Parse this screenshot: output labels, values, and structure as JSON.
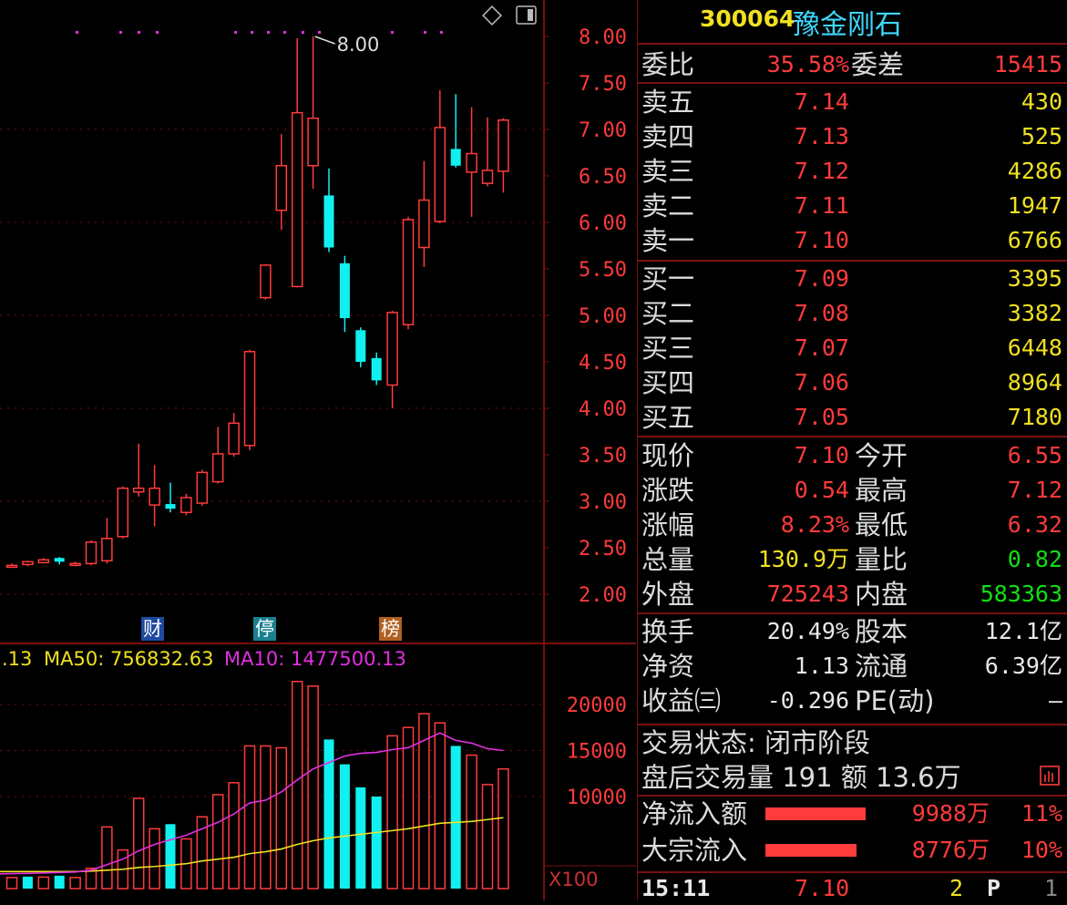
{
  "header": {
    "code": "300064",
    "name": "豫金刚石"
  },
  "window_icons": {
    "diamond": "diamond-icon",
    "toggle": "panel-toggle-icon"
  },
  "weibi": {
    "label": "委比",
    "value": "35.58%",
    "diff_label": "委差",
    "diff_value": "15415"
  },
  "sell": [
    {
      "label": "卖五",
      "price": "7.14",
      "vol": "430"
    },
    {
      "label": "卖四",
      "price": "7.13",
      "vol": "525"
    },
    {
      "label": "卖三",
      "price": "7.12",
      "vol": "4286"
    },
    {
      "label": "卖二",
      "price": "7.11",
      "vol": "1947"
    },
    {
      "label": "卖一",
      "price": "7.10",
      "vol": "6766"
    }
  ],
  "buy": [
    {
      "label": "买一",
      "price": "7.09",
      "vol": "3395"
    },
    {
      "label": "买二",
      "price": "7.08",
      "vol": "3382"
    },
    {
      "label": "买三",
      "price": "7.07",
      "vol": "6448"
    },
    {
      "label": "买四",
      "price": "7.06",
      "vol": "8964"
    },
    {
      "label": "买五",
      "price": "7.05",
      "vol": "7180"
    }
  ],
  "stats": [
    {
      "l1": "现价",
      "v1": "7.10",
      "c1": "red",
      "l2": "今开",
      "v2": "6.55",
      "c2": "red"
    },
    {
      "l1": "涨跌",
      "v1": "0.54",
      "c1": "red",
      "l2": "最高",
      "v2": "7.12",
      "c2": "red"
    },
    {
      "l1": "涨幅",
      "v1": "8.23%",
      "c1": "red",
      "l2": "最低",
      "v2": "6.32",
      "c2": "red"
    },
    {
      "l1": "总量",
      "v1": "130.9万",
      "c1": "yellow",
      "l2": "量比",
      "v2": "0.82",
      "c2": "green"
    },
    {
      "l1": "外盘",
      "v1": "725243",
      "c1": "red",
      "l2": "内盘",
      "v2": "583363",
      "c2": "green"
    }
  ],
  "stats2": [
    {
      "l1": "换手",
      "v1": "20.49%",
      "l2": "股本",
      "v2": "12.1亿"
    },
    {
      "l1": "净资",
      "v1": "1.13",
      "l2": "流通",
      "v2": "6.39亿"
    },
    {
      "l1": "收益㈢",
      "v1": "-0.296",
      "l2": "PE(动)",
      "v2": "–"
    }
  ],
  "trade_status": "交易状态: 闭市阶段",
  "after_hours": "盘后交易量 191 额 13.6万",
  "flows": [
    {
      "label": "净流入额",
      "value": "9988万",
      "pct": "11%",
      "fill": 0.11
    },
    {
      "label": "大宗流入",
      "value": "8776万",
      "pct": "10%",
      "fill": 0.1
    }
  ],
  "bottom": {
    "time": "15:11",
    "price": "7.10",
    "count": "2",
    "flag": "P",
    "num": "1"
  },
  "chart_labels": {
    "max_marker": "8.00",
    "ma_line_prefix": ".13",
    "ma50": "MA50: 756832.63",
    "ma10": "MA10: 1477500.13",
    "unit": "X100",
    "tags": [
      {
        "text": "财",
        "bg": "#1e4aa0"
      },
      {
        "text": "停",
        "bg": "#1a8090"
      },
      {
        "text": "榜",
        "bg": "#b06020"
      }
    ]
  },
  "colors": {
    "up": "#ff3b3b",
    "down": "#10f0f0",
    "grid": "#7a0f0f",
    "ma50": "#f0e020",
    "ma10": "#e030e0"
  },
  "chart_data": [
    {
      "type": "candlestick",
      "y_ticks": [
        "8.00",
        "7.50",
        "7.00",
        "6.50",
        "6.00",
        "5.50",
        "5.00",
        "4.50",
        "4.00",
        "3.50",
        "3.00",
        "2.50",
        "2.00"
      ],
      "ylim": [
        1.5,
        8.2
      ],
      "candles": [
        {
          "o": 2.31,
          "c": 2.31,
          "h": 2.33,
          "l": 2.29
        },
        {
          "o": 2.32,
          "c": 2.35,
          "h": 2.36,
          "l": 2.3
        },
        {
          "o": 2.34,
          "c": 2.37,
          "h": 2.39,
          "l": 2.33
        },
        {
          "o": 2.39,
          "c": 2.35,
          "h": 2.4,
          "l": 2.32
        },
        {
          "o": 2.33,
          "c": 2.33,
          "h": 2.35,
          "l": 2.3
        },
        {
          "o": 2.33,
          "c": 2.56,
          "h": 2.58,
          "l": 2.31
        },
        {
          "o": 2.36,
          "c": 2.6,
          "h": 2.82,
          "l": 2.33
        },
        {
          "o": 2.62,
          "c": 3.14,
          "h": 3.16,
          "l": 2.6
        },
        {
          "o": 3.1,
          "c": 3.14,
          "h": 3.62,
          "l": 3.05
        },
        {
          "o": 2.96,
          "c": 3.14,
          "h": 3.39,
          "l": 2.73
        },
        {
          "o": 2.97,
          "c": 2.92,
          "h": 3.2,
          "l": 2.88
        },
        {
          "o": 2.88,
          "c": 3.04,
          "h": 3.08,
          "l": 2.85
        },
        {
          "o": 2.98,
          "c": 3.31,
          "h": 3.34,
          "l": 2.95
        },
        {
          "o": 3.21,
          "c": 3.51,
          "h": 3.8,
          "l": 3.19
        },
        {
          "o": 3.51,
          "c": 3.84,
          "h": 3.95,
          "l": 3.48
        },
        {
          "o": 3.6,
          "c": 4.61,
          "h": 4.63,
          "l": 3.55
        },
        {
          "o": 5.19,
          "c": 5.54,
          "h": 5.55,
          "l": 5.17
        },
        {
          "o": 6.13,
          "c": 6.61,
          "h": 6.95,
          "l": 5.92
        },
        {
          "o": 5.31,
          "c": 7.18,
          "h": 7.98,
          "l": 5.3
        },
        {
          "o": 6.61,
          "c": 7.12,
          "h": 8.0,
          "l": 6.36
        },
        {
          "o": 6.29,
          "c": 5.73,
          "h": 6.58,
          "l": 5.68
        },
        {
          "o": 5.56,
          "c": 4.97,
          "h": 5.64,
          "l": 4.82
        },
        {
          "o": 4.84,
          "c": 4.5,
          "h": 4.87,
          "l": 4.44
        },
        {
          "o": 4.54,
          "c": 4.3,
          "h": 4.6,
          "l": 4.25
        },
        {
          "o": 4.25,
          "c": 5.03,
          "h": 5.05,
          "l": 4.0
        },
        {
          "o": 4.9,
          "c": 6.03,
          "h": 6.06,
          "l": 4.85
        },
        {
          "o": 5.73,
          "c": 6.24,
          "h": 6.66,
          "l": 5.52
        },
        {
          "o": 6.01,
          "c": 7.02,
          "h": 7.42,
          "l": 5.99
        },
        {
          "o": 6.79,
          "c": 6.61,
          "h": 7.38,
          "l": 6.59
        },
        {
          "o": 6.54,
          "c": 6.74,
          "h": 7.24,
          "l": 6.06
        },
        {
          "o": 6.42,
          "c": 6.56,
          "h": 7.13,
          "l": 6.39
        },
        {
          "o": 6.55,
          "c": 7.1,
          "h": 7.12,
          "l": 6.32
        }
      ]
    },
    {
      "type": "bar",
      "y_ticks": [
        "20000",
        "15000",
        "10000"
      ],
      "ylim": [
        0,
        23000
      ],
      "volumes": [
        {
          "v": 1200,
          "up": true
        },
        {
          "v": 1300,
          "up": false
        },
        {
          "v": 1250,
          "up": true
        },
        {
          "v": 1400,
          "up": false
        },
        {
          "v": 1200,
          "up": true
        },
        {
          "v": 2200,
          "up": true
        },
        {
          "v": 6700,
          "up": true
        },
        {
          "v": 4200,
          "up": true
        },
        {
          "v": 9800,
          "up": true
        },
        {
          "v": 6500,
          "up": true
        },
        {
          "v": 7000,
          "up": false
        },
        {
          "v": 5400,
          "up": true
        },
        {
          "v": 7800,
          "up": true
        },
        {
          "v": 10200,
          "up": true
        },
        {
          "v": 11500,
          "up": true
        },
        {
          "v": 15500,
          "up": true
        },
        {
          "v": 15500,
          "up": true
        },
        {
          "v": 15300,
          "up": true
        },
        {
          "v": 22500,
          "up": true
        },
        {
          "v": 22000,
          "up": true
        },
        {
          "v": 16200,
          "up": false
        },
        {
          "v": 13500,
          "up": false
        },
        {
          "v": 11000,
          "up": false
        },
        {
          "v": 10000,
          "up": false
        },
        {
          "v": 16600,
          "up": true
        },
        {
          "v": 17500,
          "up": true
        },
        {
          "v": 19000,
          "up": true
        },
        {
          "v": 18000,
          "up": true
        },
        {
          "v": 15500,
          "up": false
        },
        {
          "v": 14500,
          "up": true
        },
        {
          "v": 11300,
          "up": true
        },
        {
          "v": 13000,
          "up": true
        }
      ],
      "ma10": [
        1600,
        1650,
        1700,
        1750,
        1800,
        2000,
        2600,
        3200,
        4100,
        4800,
        5300,
        5800,
        6500,
        7200,
        8100,
        9300,
        9600,
        10500,
        11800,
        13000,
        13700,
        14400,
        14700,
        14800,
        15100,
        15300,
        16100,
        16900,
        16100,
        15800,
        15200,
        15000
      ],
      "ma50": [
        1850,
        1850,
        1850,
        1850,
        1850,
        1900,
        2000,
        2100,
        2300,
        2400,
        2550,
        2700,
        3000,
        3200,
        3400,
        3800,
        4000,
        4300,
        4800,
        5200,
        5500,
        5700,
        5900,
        6100,
        6300,
        6500,
        6800,
        7100,
        7200,
        7300,
        7500,
        7700
      ]
    }
  ]
}
